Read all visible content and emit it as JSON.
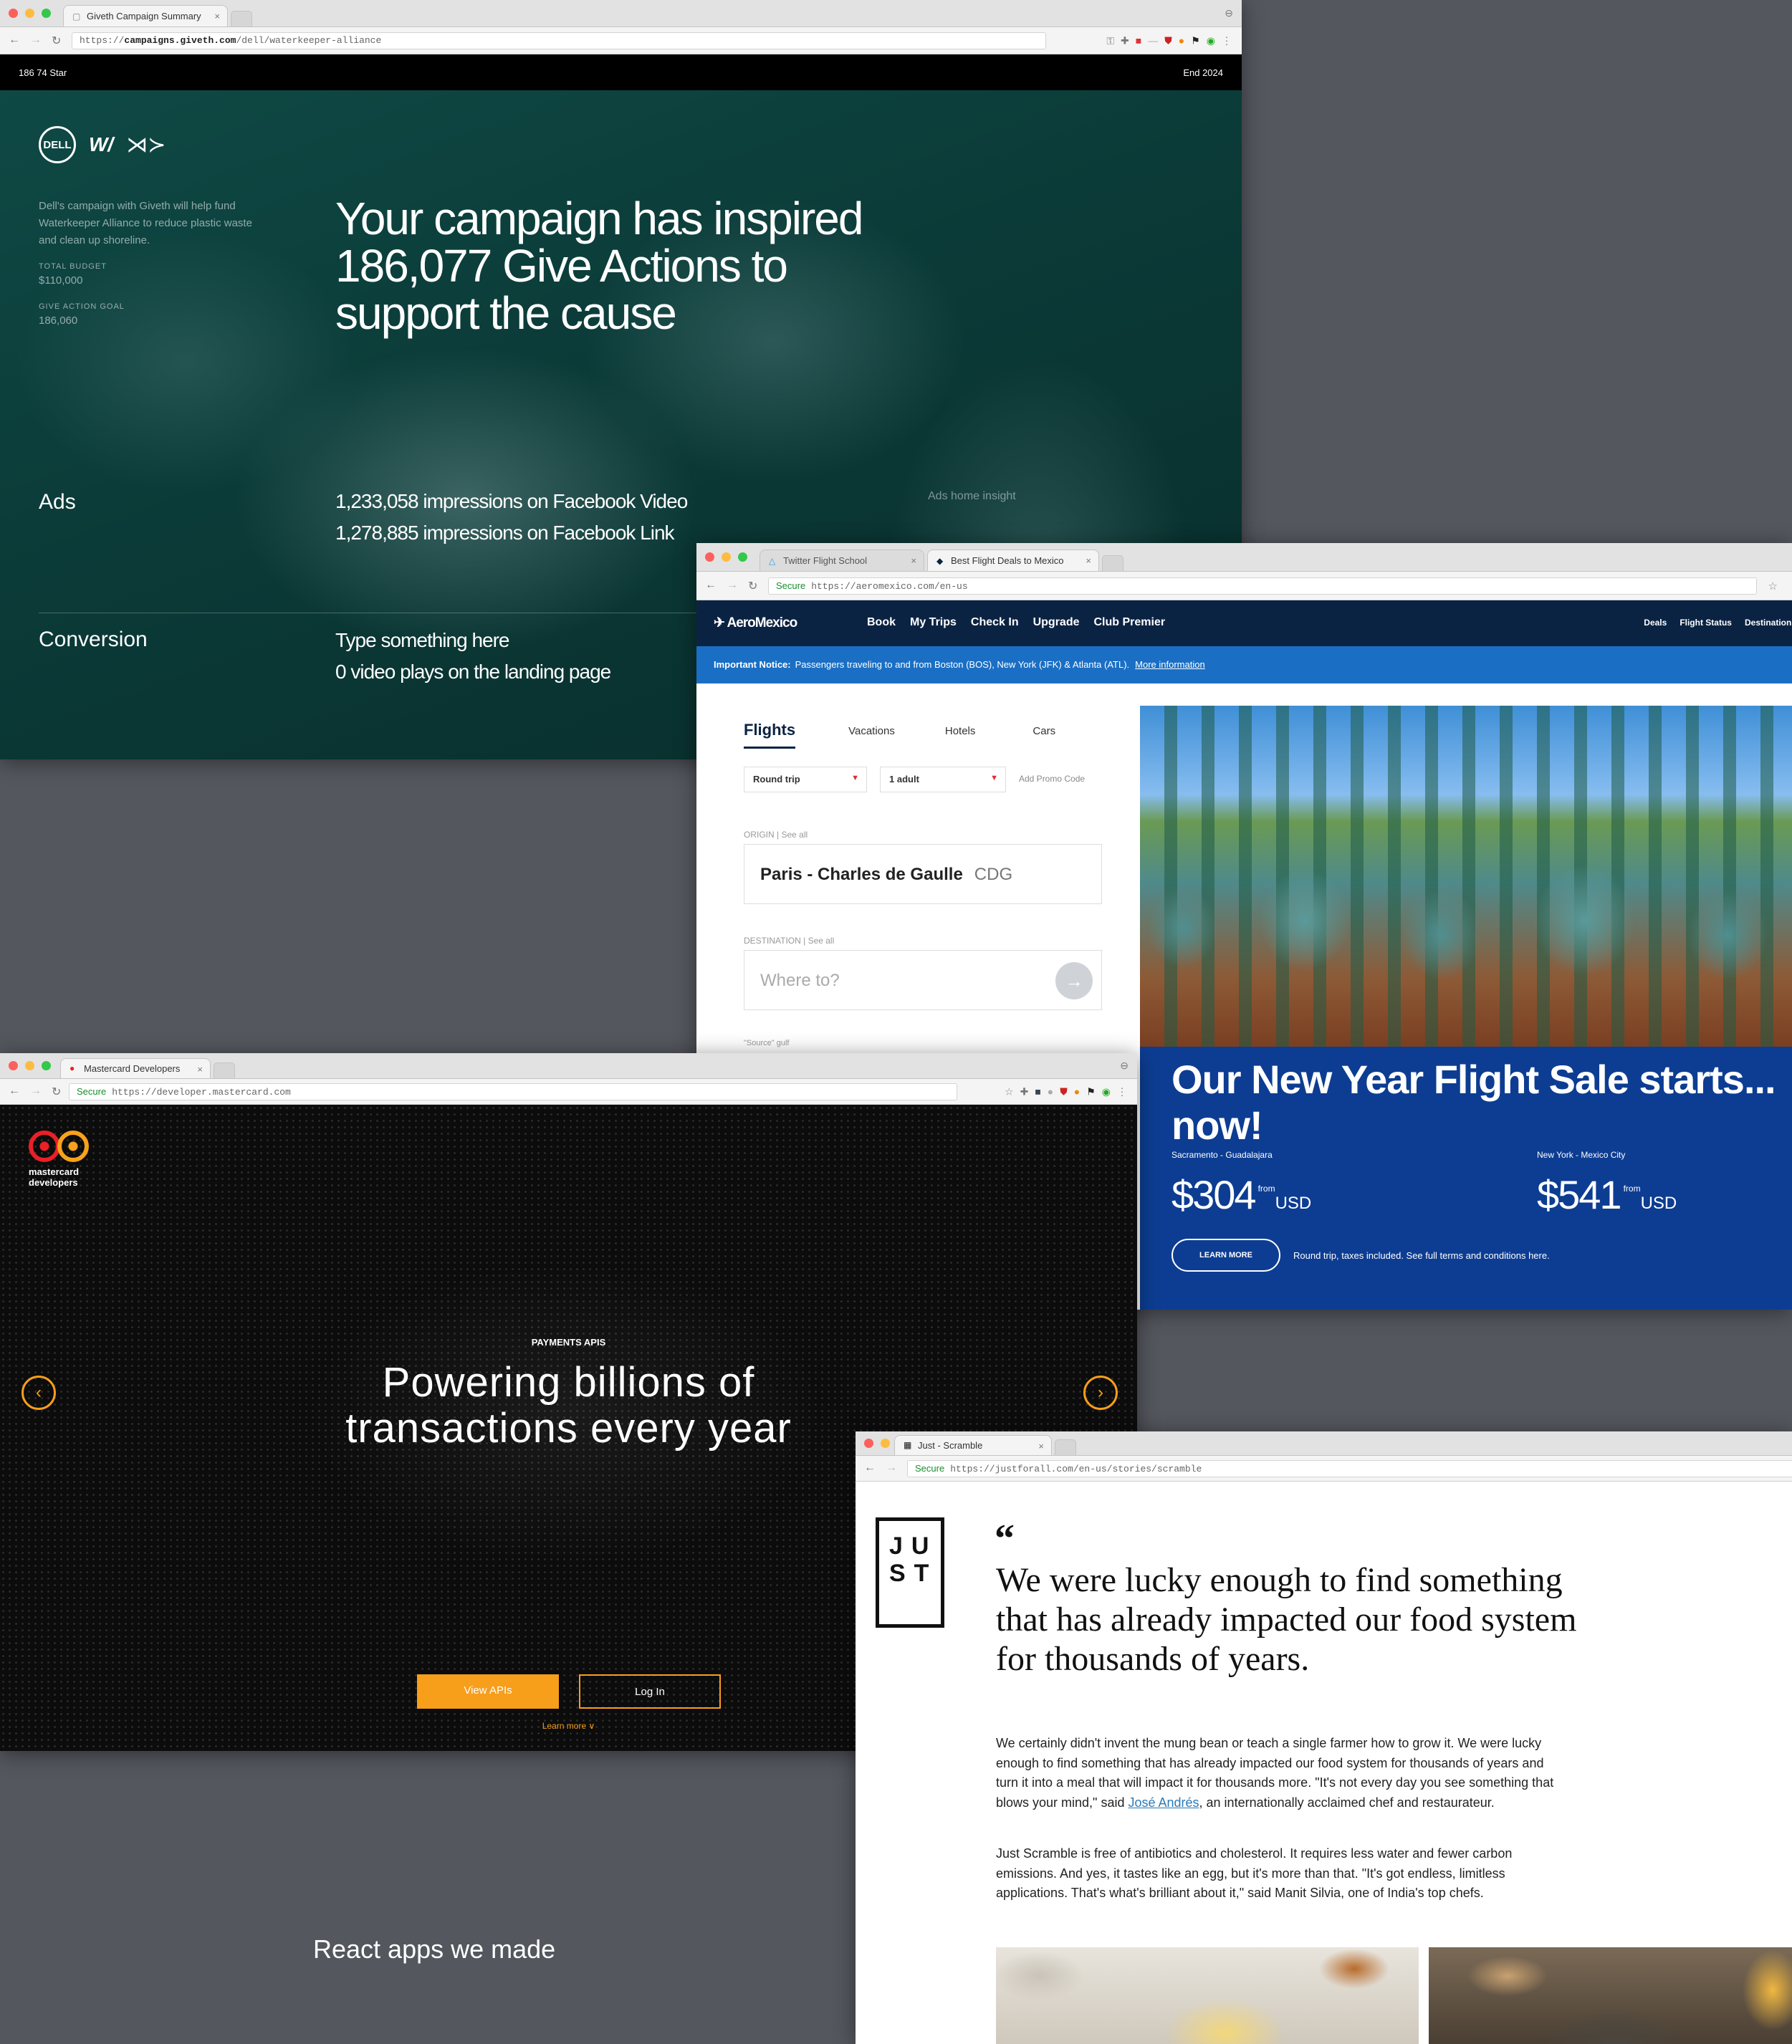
{
  "giveth": {
    "tab_title": "Giveth Campaign Summary",
    "url_prefix": "https://",
    "url_domain": "campaigns.giveth.com",
    "url_path": "/dell/waterkeeper-alliance",
    "topbar_left": "186 74 Star",
    "topbar_right": "End 2024",
    "logo_dell": "DELL",
    "logo_w": "W/",
    "side_text": "Dell's campaign with Giveth will help fund Waterkeeper Alliance to reduce plastic waste and clean up shoreline.",
    "total_budget_label": "TOTAL BUDGET",
    "total_budget_value": "$110,000",
    "give_action_goal_label": "GIVE ACTION GOAL",
    "give_action_goal_value": "186,060",
    "headline": "Your campaign has inspired 186,077 Give Actions to support the cause",
    "ads_label": "Ads",
    "ads_line1": "1,233,058 impressions on Facebook Video",
    "ads_line2": "1,278,885 impressions on Facebook Link",
    "ads_note": "Ads home insight",
    "conversion_label": "Conversion",
    "conversion_line1": "Type something here",
    "conversion_line2": "0 video plays on the landing page"
  },
  "aeromexico": {
    "tab1_title": "Twitter Flight School",
    "tab2_title": "Best Flight Deals to Mexico",
    "secure_label": "Secure",
    "url": "https://aeromexico.com/en-us",
    "logo": "AeroMexico",
    "menu": [
      "Book",
      "My Trips",
      "Check In",
      "Upgrade",
      "Club Premier"
    ],
    "right_menu": [
      "Deals",
      "Flight Status",
      "Destinations"
    ],
    "notice_bold": "Important Notice:",
    "notice_text": "Passengers traveling to and from Boston (BOS), New York (JFK) & Atlanta (ATL).",
    "notice_link": "More information",
    "tabs": [
      "Flights",
      "Vacations",
      "Hotels",
      "Cars"
    ],
    "trip_type": "Round trip",
    "passengers": "1 adult",
    "promo": "Add Promo Code",
    "origin_label": "ORIGIN | See all",
    "origin_value": "Paris - Charles de Gaulle",
    "origin_code": "CDG",
    "destination_label": "DESTINATION | See all",
    "destination_placeholder": "Where to?",
    "go_arrow": "→",
    "bottom_label": "\"Source\" gulf",
    "sale_headline_line1": "Our New Year Flight Sale starts...",
    "sale_headline_line2": "now!",
    "route1": "Sacramento - Guadalajara",
    "price1": "$304",
    "price1_from": "from",
    "price1_currency": "USD",
    "route2": "New York - Mexico City",
    "price2": "$541",
    "price2_from": "from",
    "price2_currency": "USD",
    "learn_more": "LEARN MORE",
    "footnote": "Round trip, taxes included. See full terms and conditions here."
  },
  "mastercard": {
    "tab_title": "Mastercard Developers",
    "secure_label": "Secure",
    "url": "https://developer.mastercard.com",
    "logo_line1": "mastercard",
    "logo_line2": "developers",
    "eyebrow": "PAYMENTS APIS",
    "headline_line1": "Powering billions of",
    "headline_line2": "transactions every year",
    "prev_arrow": "‹",
    "next_arrow": "›",
    "primary_button": "View APIs",
    "secondary_button": "Log In",
    "learn_more": "Learn more ∨"
  },
  "just": {
    "tab_title": "Just - Scramble",
    "secure_label": "Secure",
    "url": "https://justforall.com/en-us/stories/scramble",
    "logo_row1": "JU",
    "logo_row2": "ST",
    "quote_mark": "“",
    "headline": "We were lucky enough to find something that has already impacted our food system for thousands of years.",
    "p1_before": "We certainly didn't invent the mung bean or teach a single farmer how to grow it. We were lucky enough to find something that has already impacted our food system for thousands of years and turn it into a meal that will impact it for thousands more. \"It's not every day you see something that blows your mind,\" said ",
    "p1_link": "José Andrés",
    "p1_after": ", an internationally acclaimed chef and restaurateur.",
    "p2": "Just Scramble is free of antibiotics and cholesterol. It requires less water and fewer carbon emissions. And yes, it tastes like an egg, but it's more than that. \"It's got endless, limitless applications. That's what's brilliant about it,\" said Manit Silvia, one of India's top chefs."
  },
  "caption": "React apps we made",
  "colors": {
    "background": "#54575e",
    "giveth_teal": "#0d3b38",
    "aeromexico_navy": "#0b2343",
    "aeromexico_blue": "#0d3d92",
    "mastercard_orange": "#f79e1b",
    "mastercard_red": "#ea2026"
  }
}
